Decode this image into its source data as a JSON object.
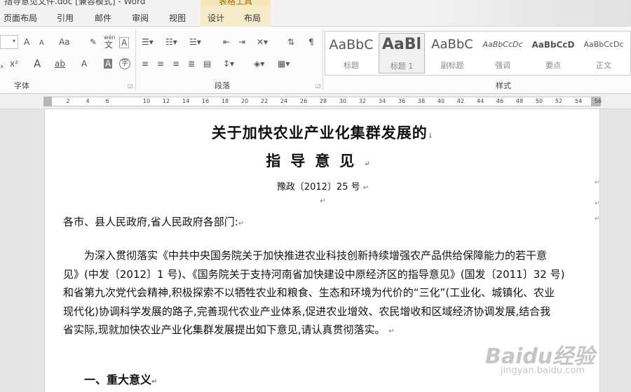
{
  "titlebar": {
    "title": "指导意见文件.doc [兼容模式] - Word",
    "context_group": "表格工具"
  },
  "tabs": [
    "页面布局",
    "引用",
    "邮件",
    "审阅",
    "视图",
    "设计",
    "布局"
  ],
  "ribbon": {
    "font": {
      "label": "字体",
      "buttons": {
        "grow": "A",
        "shrink": "A",
        "case": "Aa",
        "clear": "✎",
        "phonetic_top": "wén",
        "phonetic": "文",
        "border": "A",
        "superscript": "x²",
        "effects": "A",
        "highlight": "ab",
        "color": "A",
        "shade": "A",
        "enclose": "字"
      }
    },
    "paragraph": {
      "label": "段落"
    },
    "styles": {
      "label": "样式",
      "items": [
        {
          "preview": "AaBbC",
          "name": "标题"
        },
        {
          "preview": "AaBl",
          "name": "标题 1"
        },
        {
          "preview": "AaBbC",
          "name": "副标题"
        },
        {
          "preview": "AaBbCcDc",
          "name": "强调"
        },
        {
          "preview": "AaBbCcD",
          "name": "要点"
        },
        {
          "preview": "AaBbCcDc",
          "name": "正文"
        }
      ]
    }
  },
  "ruler": {
    "ticks": [
      "2",
      "4",
      "6",
      "10",
      "12",
      "14",
      "16",
      "18",
      "20",
      "22",
      "24",
      "26",
      "28",
      "30",
      "32",
      "34",
      "36",
      "38",
      "40",
      "42",
      "44",
      "46",
      "48",
      "50",
      "52",
      "54",
      "56"
    ]
  },
  "document": {
    "title_line1": "关于加快农业产业化集群发展的",
    "title_line2": "指导意见",
    "doc_number": "豫政〔2012〕25 号",
    "salutation": "各市、县人民政府,省人民政府各部门:",
    "paragraph_lines": [
      "为深入贯彻落实《中共中央国务院关于加快推进农业科技创新持续增强农产品供给保障能力的若干意",
      "见》(中发〔2012〕1 号)、《国务院关于支持河南省加快建设中原经济区的指导意见》(国发〔2011〕32 号)",
      "和省第九次党代会精神,积极探索不以牺牲农业和粮食、生态和环境为代价的“三化”(工业化、城镇化、农业",
      "现代化)协调科学发展的路子,完善现代农业产业体系,促进农业增效、农民增收和区域经济协调发展,结合我",
      "省实际,现就加快农业产业化集群发展提出如下意见,请认真贯彻落实。"
    ],
    "heading": "一、重大意义"
  },
  "marks": {
    "paragraph": "↵",
    "line_end": "↓"
  },
  "watermark": {
    "main": "Baidu经验",
    "sub": "jingyan.baidu.com"
  },
  "colors": {
    "context_tab": "#f7ecc9",
    "page": "#ffffff",
    "workspace": "#e6e6e6"
  }
}
